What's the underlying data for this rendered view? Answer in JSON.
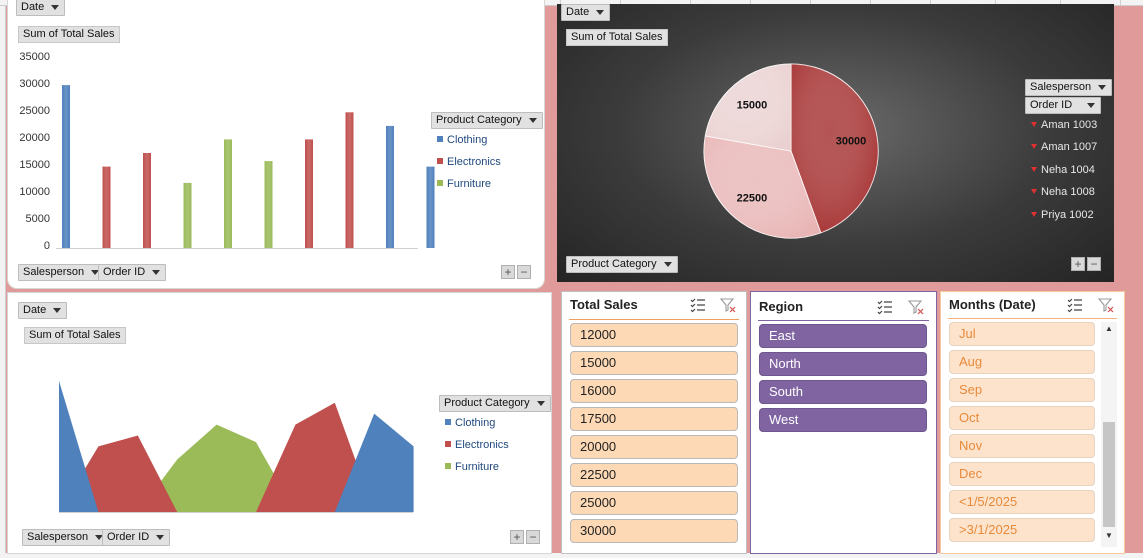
{
  "colors": {
    "clothing": "#4f81bd",
    "electronics": "#c0504d",
    "furniture": "#9bbb59",
    "region_chip": "#8064a2",
    "sales_chip": "#fdd9b5",
    "month_chip": "#fde3cc",
    "month_text": "#e88a3a"
  },
  "bar_panel": {
    "date_filter": "Date",
    "value_label": "Sum of Total Sales",
    "legend_filter": "Product Category",
    "axis_filters": [
      "Salesperson",
      "Order ID"
    ],
    "legend": [
      "Clothing",
      "Electronics",
      "Furniture"
    ]
  },
  "pie_panel": {
    "date_filter": "Date",
    "value_label": "Sum of Total Sales",
    "legend_filters": [
      "Salesperson",
      "Order ID"
    ],
    "legend": [
      "Aman 1003",
      "Aman 1007",
      "Neha 1004",
      "Neha 1008",
      "Priya 1002"
    ],
    "axis_filter": "Product Category"
  },
  "area_panel": {
    "date_filter": "Date",
    "value_label": "Sum of Total Sales",
    "legend_filter": "Product Category",
    "axis_filters": [
      "Salesperson",
      "Order ID"
    ],
    "legend": [
      "Clothing",
      "Electronics",
      "Furniture"
    ]
  },
  "zoom": {
    "plus": "+",
    "minus": "−"
  },
  "chart_data": [
    {
      "type": "bar",
      "ylim": [
        0,
        35000
      ],
      "yticks": [
        "35000",
        "30000",
        "25000",
        "20000",
        "15000",
        "10000",
        "5000",
        "0"
      ],
      "categories": [
        "",
        "",
        "",
        "",
        "",
        "",
        "",
        "",
        "",
        ""
      ],
      "series": [
        {
          "name": "Clothing",
          "values": [
            30000,
            null,
            null,
            null,
            null,
            null,
            null,
            null,
            22500,
            15000
          ]
        },
        {
          "name": "Electronics",
          "values": [
            null,
            15000,
            17500,
            null,
            null,
            null,
            20000,
            25000,
            null,
            null
          ]
        },
        {
          "name": "Furniture",
          "values": [
            null,
            null,
            null,
            12000,
            20000,
            16000,
            null,
            null,
            null,
            null
          ]
        }
      ],
      "legend": "right",
      "grid": false
    },
    {
      "type": "pie",
      "slices": [
        {
          "label": "30000",
          "value": 30000,
          "color": "#a22a2a"
        },
        {
          "label": "22500",
          "value": 22500,
          "color": "#e8b4b4"
        },
        {
          "label": "15000",
          "value": 15000,
          "color": "#ead0d0"
        }
      ]
    },
    {
      "type": "area",
      "categories": [
        "",
        "",
        "",
        "",
        "",
        "",
        "",
        "",
        "",
        ""
      ],
      "ylim": [
        0,
        35000
      ],
      "series": [
        {
          "name": "Clothing",
          "values": [
            30000,
            null,
            null,
            null,
            null,
            null,
            null,
            null,
            22500,
            15000
          ]
        },
        {
          "name": "Electronics",
          "values": [
            null,
            15000,
            17500,
            null,
            null,
            null,
            20000,
            25000,
            null,
            null
          ]
        },
        {
          "name": "Furniture",
          "values": [
            null,
            null,
            null,
            12000,
            20000,
            16000,
            null,
            null,
            null,
            null
          ]
        }
      ],
      "legend": "right",
      "grid": false
    }
  ],
  "slicers": {
    "total_sales": {
      "title": "Total Sales",
      "items": [
        "12000",
        "15000",
        "16000",
        "17500",
        "20000",
        "22500",
        "25000",
        "30000"
      ]
    },
    "region": {
      "title": "Region",
      "items": [
        "East",
        "North",
        "South",
        "West"
      ]
    },
    "months": {
      "title": "Months (Date)",
      "items": [
        "Jul",
        "Aug",
        "Sep",
        "Oct",
        "Nov",
        "Dec",
        "<1/5/2025",
        ">3/1/2025"
      ],
      "scroll_up": "▲",
      "scroll_down": "▼"
    }
  },
  "icons": {
    "multiselect": "multi-select-icon",
    "clear_filter": "clear-filter-icon"
  }
}
